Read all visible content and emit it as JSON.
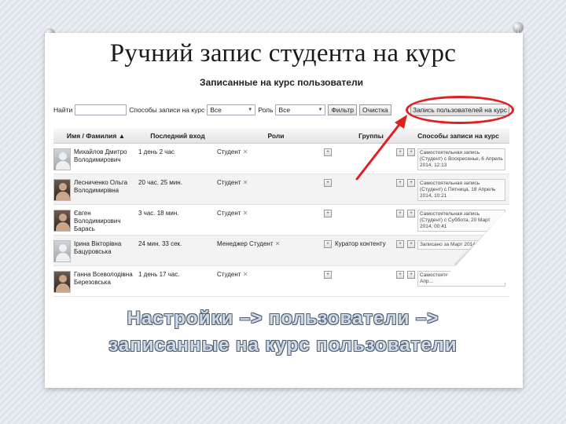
{
  "slide": {
    "title": "Ручний запис студента на курс",
    "caption_line1": "Настройки –> пользователи –>",
    "caption_line2": "записанные на курс пользователи"
  },
  "screenshot": {
    "title": "Записанные на курс пользователи",
    "filter": {
      "find_label": "Найти",
      "find_value": "",
      "methods_label": "Способы записи на курс",
      "methods_value": "Все",
      "role_label": "Роль",
      "role_value": "Все",
      "filter_button": "Фильтр",
      "clear_button": "Очистка"
    },
    "enrol_button": "Запись пользователей на курс",
    "columns": [
      "Имя / Фамилия ▲",
      "Последний вход",
      "Роли",
      "Группы",
      "Способы записи на курс"
    ],
    "rows": [
      {
        "name": "Михайлов Дмитро Володимирович",
        "last": "1 день 2 час",
        "roles": "Студент",
        "groups": "",
        "enrol": "Самостоятельная запись (Студент) с Воскресенье, 6 Апрель 2014, 12:13",
        "photo": false
      },
      {
        "name": "Лесниченко Ольга Володимирівна",
        "last": "20 час. 25 мин.",
        "roles": "Студент",
        "groups": "",
        "enrol": "Самостоятельная запись (Студент) с Пятница, 18 Апрель 2014, 10:21",
        "photo": true
      },
      {
        "name": "Євген Володимирович Барась",
        "last": "3 час. 18 мин.",
        "roles": "Студент",
        "groups": "",
        "enrol": "Самостоятельная запись (Студент) с Суббота, 20 Март 2014, 00:41",
        "photo": true
      },
      {
        "name": "Ірина Вікторівна Бацуровська",
        "last": "24 мин. 33 сек.",
        "roles": "Менеджер  Студент",
        "groups": "Куратор контенту",
        "enrol": "Записано за Март 2014, 00:..",
        "photo": false
      },
      {
        "name": "Ганна Всеволодівна Березовська",
        "last": "1 день 17 час.",
        "roles": "Студент",
        "groups": "",
        "enrol": "Самостоятельная ... Пятница, 18 Апр...",
        "photo": true
      }
    ]
  },
  "colors": {
    "accent_red": "#e02020",
    "caption_fill": "#cfd9e6",
    "caption_outline": "#4f5f73"
  },
  "icons": [
    "pin-icon",
    "sort-ascending-icon",
    "dropdown-arrow-icon",
    "remove-x-icon",
    "add-icon",
    "arrow-icon",
    "page-curl-icon"
  ]
}
